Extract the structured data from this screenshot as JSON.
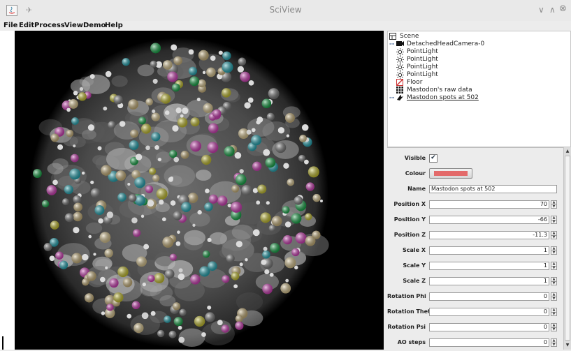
{
  "window": {
    "title": "SciView",
    "controls": [
      "∨",
      "∧",
      "⊗"
    ]
  },
  "menu": [
    "File",
    "Edit",
    "Process",
    "View",
    "Demo",
    "Help"
  ],
  "scene_tree": {
    "root": "Scene",
    "nodes": [
      {
        "label": "DetachedHeadCamera-0",
        "icon": "camera-icon",
        "expandable": true
      },
      {
        "label": "PointLight",
        "icon": "point-light-icon",
        "expandable": false
      },
      {
        "label": "PointLight",
        "icon": "point-light-icon",
        "expandable": false
      },
      {
        "label": "PointLight",
        "icon": "point-light-icon",
        "expandable": false
      },
      {
        "label": "PointLight",
        "icon": "point-light-icon",
        "expandable": false
      },
      {
        "label": "Floor",
        "icon": "floor-icon",
        "expandable": false
      },
      {
        "label": "Mastodon's raw data",
        "icon": "volume-icon",
        "expandable": false
      },
      {
        "label": "Mastodon spots at 502",
        "icon": "spots-icon",
        "expandable": true,
        "selected": true
      }
    ]
  },
  "properties": {
    "visible": {
      "label": "Visible",
      "checked": true
    },
    "colour": {
      "label": "Colour",
      "value": "#e36a6a"
    },
    "name": {
      "label": "Name",
      "value": "Mastodon spots at 502"
    },
    "fields": [
      {
        "key": "position-x",
        "label": "Position X",
        "value": "70"
      },
      {
        "key": "position-y",
        "label": "Position Y",
        "value": "-66"
      },
      {
        "key": "position-z",
        "label": "Position Z",
        "value": "-11.3"
      },
      {
        "key": "scale-x",
        "label": "Scale X",
        "value": "1"
      },
      {
        "key": "scale-y",
        "label": "Scale Y",
        "value": "1"
      },
      {
        "key": "scale-z",
        "label": "Scale Z",
        "value": "1"
      },
      {
        "key": "rotation-phi",
        "label": "Rotation Phi",
        "value": "0"
      },
      {
        "key": "rotation-theta",
        "label": "Rotation Theta",
        "value": "0"
      },
      {
        "key": "rotation-psi",
        "label": "Rotation Psi",
        "value": "0"
      },
      {
        "key": "ao-steps",
        "label": "AO steps",
        "value": "0"
      }
    ]
  }
}
